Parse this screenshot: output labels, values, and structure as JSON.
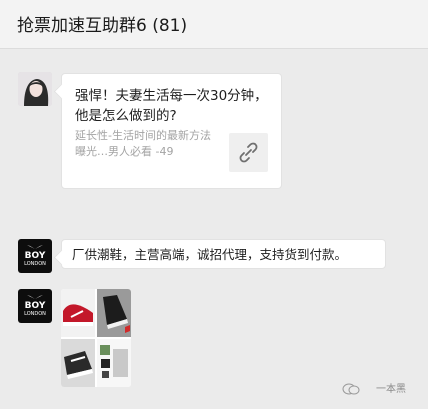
{
  "header": {
    "title": "抢票加速互助群6 (81)"
  },
  "messages": {
    "link": {
      "title": "强悍！夫妻生活每一次30分钟，他是怎么做到的?",
      "desc": "延长性-生活时间的最新方法曝光…男人必看 -49"
    },
    "text": {
      "content": "厂供潮鞋，主营高端，诚招代理，支持货到付款。"
    }
  },
  "avatar": {
    "boy_text": "BOY",
    "boy_sub": "LONDON"
  },
  "watermark": {
    "text": "一本黑"
  },
  "icons": [
    "link-icon",
    "wechat-watermark-icon"
  ]
}
